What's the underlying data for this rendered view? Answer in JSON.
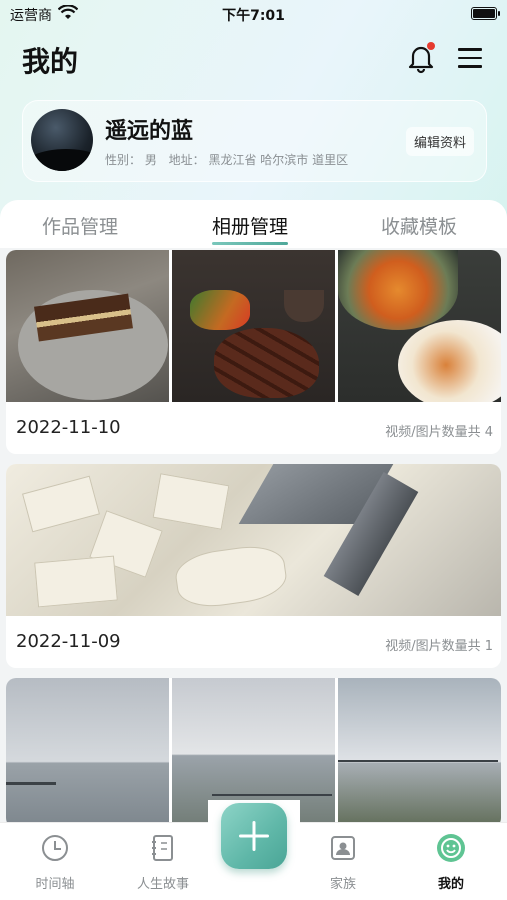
{
  "status_bar": {
    "carrier": "运营商",
    "time": "下午7:01"
  },
  "header": {
    "title": "我的"
  },
  "profile": {
    "name": "遥远的蓝",
    "gender": "性别：  男",
    "address": "地址：  黑龙江省  哈尔滨市  道里区",
    "edit_label": "编辑资料"
  },
  "tabs": [
    {
      "label": "作品管理"
    },
    {
      "label": "相册管理"
    },
    {
      "label": "收藏模板"
    }
  ],
  "albums": [
    {
      "date": "2022-11-10",
      "count_text": "视频/图片数量共 4"
    },
    {
      "date": "2022-11-09",
      "count_text": "视频/图片数量共 1"
    }
  ],
  "bottom_nav": [
    {
      "label": "时间轴",
      "icon": "clock-icon"
    },
    {
      "label": "人生故事",
      "icon": "notebook-icon"
    },
    {
      "label": "家族",
      "icon": "family-photo-icon"
    },
    {
      "label": "我的",
      "icon": "smiley-profile-icon"
    }
  ],
  "colors": {
    "accent": "#5fb7a8",
    "notification_dot": "#e53a2f"
  }
}
